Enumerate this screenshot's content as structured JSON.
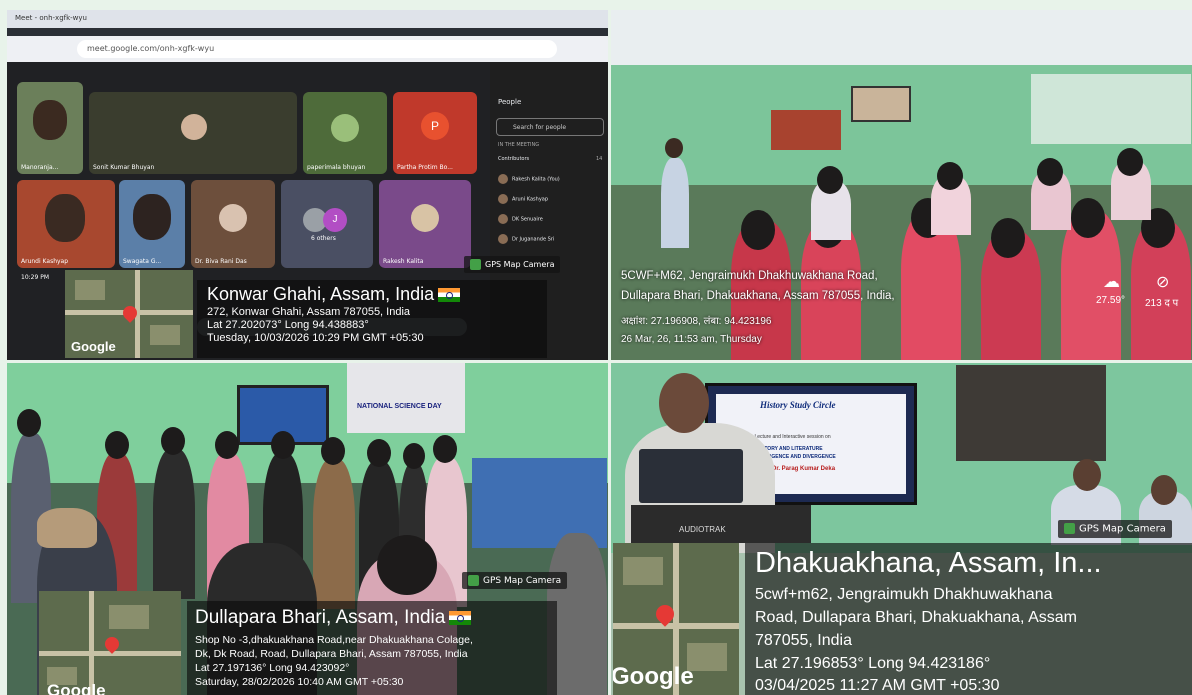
{
  "tile1": {
    "tab_title": "Meet - onh-xgfk-wyu",
    "url": "meet.google.com/onh-xgfk-wyu",
    "participants": [
      {
        "name": "Manoranja..."
      },
      {
        "name": "Sonit Kumar Bhuyan"
      },
      {
        "name": "paperimala bhuyan"
      },
      {
        "name": "Partha Protim Bo..."
      },
      {
        "name": "Arundi Kashyap"
      },
      {
        "name": "Swagata G..."
      },
      {
        "name": "Dr. Biva Rani Das"
      },
      {
        "name": "6 others"
      },
      {
        "name": "Rakesh Kalita"
      }
    ],
    "avatar_letters": [
      "P",
      "J"
    ],
    "people_panel": {
      "title": "People",
      "search_placeholder": "Search for people",
      "section_label": "IN THE MEETING",
      "contributors_label": "Contributors",
      "contributors_count": "14",
      "list": [
        "Rakesh Kalita (You)",
        "Aruni Kashyap",
        "DK Senuaire",
        "Dr Juganande Sri"
      ]
    },
    "clock": "10:29 PM",
    "gps_cam": "GPS Map Camera",
    "location_title": "Konwar Ghahi, Assam, India",
    "address": "272, Konwar Ghahi, Assam 787055, India",
    "latlong": "Lat 27.202073° Long 94.438883°",
    "datetime": "Tuesday, 10/03/2026 10:29 PM GMT +05:30",
    "google": "Google"
  },
  "tile2": {
    "address_line1": "5CWF+M62, Jengraimukh Dhakhuwakhana Road,",
    "address_line2": "Dullapara Bhari, Dhakuakhana, Assam 787055, India,",
    "latlong": "अक्षांश: 27.196908, लंबा: 94.423196",
    "datetime": "26 Mar, 26, 11:53 am, Thursday",
    "temperature": "27.59°",
    "heading": "213 द प"
  },
  "tile3": {
    "banner": "NATIONAL SCIENCE DAY",
    "gps_cam": "GPS Map Camera",
    "location_title": "Dullapara Bhari, Assam, India",
    "address_line1": "Shop No -3,dhakuakhana Road,near Dhakuakhana Colage,",
    "address_line2": "Dk, Dk Road, Road, Dullapara Bhari, Assam 787055, India",
    "latlong": "Lat 27.197136° Long 94.423092°",
    "datetime": "Saturday, 28/02/2026 10:40 AM GMT +05:30",
    "google": "Google"
  },
  "tile4": {
    "screen_title": "History Study Circle",
    "screen_line1": "A Lecture and Interactive session on",
    "screen_line2": "HISTORY AND LITERATURE",
    "screen_line3": "CONVERGENCE AND DIVERGENCE",
    "screen_speaker": "Dr. Parag Kumar Deka",
    "podium_brand": "AUDIOTRAK",
    "gps_cam": "GPS Map Camera",
    "location_title": "Dhakuakhana, Assam, In...",
    "address_line1": "5cwf+m62, Jengraimukh Dhakhuwakhana",
    "address_line2": "Road, Dullapara Bhari, Dhakuakhana, Assam",
    "address_line3": "787055, India",
    "latlong": "Lat 27.196853° Long 94.423186°",
    "datetime": "03/04/2025 11:27 AM GMT +05:30",
    "google": "Google"
  }
}
